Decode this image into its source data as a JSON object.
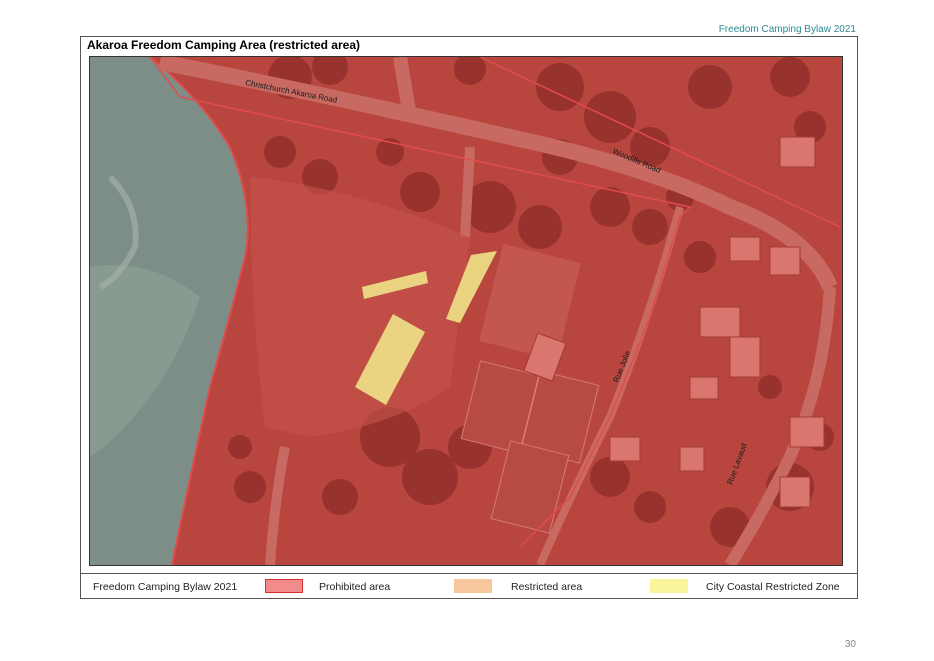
{
  "header": {
    "document_title": "Freedom Camping Bylaw 2021"
  },
  "map": {
    "title": "Akaroa Freedom Camping Area (restricted area)",
    "road_labels": {
      "christchurch_akaroa": "Christchurch Akaroa Road",
      "woodills": "Woodills Road",
      "rue_jolie": "Rue Jolie",
      "rue_lavaud": "Rue Lavaud"
    },
    "colors": {
      "prohibited": "#e35a5a",
      "restricted": "#f6c38c",
      "coastal_restricted": "#f8f48c"
    }
  },
  "legend": {
    "title": "Freedom Camping Bylaw 2021",
    "items": [
      {
        "label": "Prohibited area",
        "color": "#f28b8b",
        "border": "#d22f2f"
      },
      {
        "label": "Restricted area",
        "color": "#f5c79a",
        "border": "#f5c79a"
      },
      {
        "label": "City Coastal Restricted Zone",
        "color": "#f8f59a",
        "border": "#f8f59a"
      }
    ]
  },
  "footer": {
    "page_number": "30"
  }
}
